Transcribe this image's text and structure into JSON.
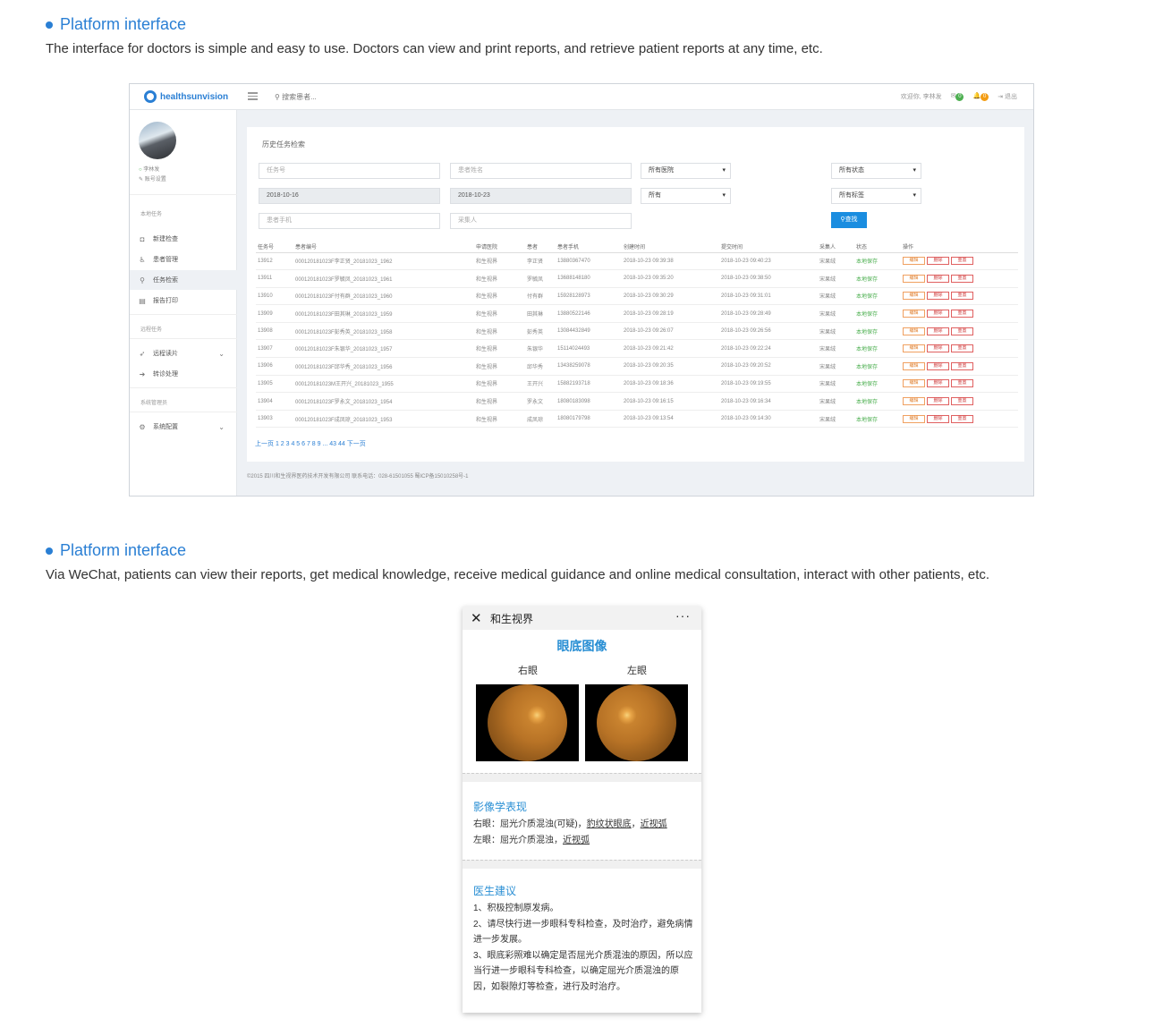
{
  "section1": {
    "title": "Platform interface",
    "desc": "The interface for doctors is simple and easy to use. Doctors can view and print reports, and retrieve patient reports at any time, etc."
  },
  "section2": {
    "title": "Platform interface",
    "desc": "Via WeChat, patients can view their reports, get medical knowledge, receive medical guidance and online medical consultation, interact with other patients, etc."
  },
  "dashboard": {
    "logo": "healthsunvision",
    "search_placeholder": "搜索患者...",
    "welcome": "欢迎你, 李林发",
    "badge_mail": "0",
    "badge_bell": "0",
    "logout": "退出",
    "user_name": "李林发",
    "account_settings": "账号设置",
    "groups": {
      "local": "本地任务",
      "remote": "远程任务",
      "admin": "系统管理员"
    },
    "nav": {
      "new_exam": "新建检查",
      "patient_mgmt": "患者管理",
      "task_search": "任务检索",
      "report_print": "报告打印",
      "remote_read": "远程读片",
      "referral": "转诊处理",
      "sys_config": "系统配置"
    },
    "panel_title": "历史任务检索",
    "filters": {
      "task_no": "任务号",
      "patient_name": "患者姓名",
      "hospital": "所有医院",
      "status": "所有状态",
      "date_from": "2018-10-16",
      "date_to": "2018-10-23",
      "all": "所有",
      "tags": "所有标签",
      "patient_phone": "患者手机",
      "collector": "采集人",
      "find_button": "查找"
    },
    "columns": [
      "任务号",
      "患者编号",
      "申请医院",
      "患者",
      "患者手机",
      "创建时间",
      "提交时间",
      "采集人",
      "状态",
      "操作"
    ],
    "rows": [
      [
        "13912",
        "000120181023F李正贤_20181023_1962",
        "和生视界",
        "李正贤",
        "13880367470",
        "2018-10-23 09:39:38",
        "2018-10-23 09:40:23",
        "宋果绒",
        "本地保存"
      ],
      [
        "13911",
        "000120181023F罗毓凤_20181023_1961",
        "和生视界",
        "罗毓凤",
        "13688148180",
        "2018-10-23 09:35:20",
        "2018-10-23 09:38:50",
        "宋果绒",
        "本地保存"
      ],
      [
        "13910",
        "000120181023F付有群_20181023_1960",
        "和生视界",
        "付有群",
        "15928128973",
        "2018-10-23 09:30:29",
        "2018-10-23 09:31:01",
        "宋果绒",
        "本地保存"
      ],
      [
        "13909",
        "000120181023F田其琳_20181023_1959",
        "和生视界",
        "田其琳",
        "13880522146",
        "2018-10-23 09:28:19",
        "2018-10-23 09:28:49",
        "宋果绒",
        "本地保存"
      ],
      [
        "13908",
        "000120181023F彭秀英_20181023_1958",
        "和生视界",
        "彭秀英",
        "13084432849",
        "2018-10-23 09:26:07",
        "2018-10-23 09:26:56",
        "宋果绒",
        "本地保存"
      ],
      [
        "13907",
        "000120181023F朱银华_20181023_1957",
        "和生视界",
        "朱银华",
        "15114024493",
        "2018-10-23 09:21:42",
        "2018-10-23 09:22:24",
        "宋果绒",
        "本地保存"
      ],
      [
        "13906",
        "000120181023F邱华秀_20181023_1956",
        "和生视界",
        "邱华秀",
        "13438259078",
        "2018-10-23 09:20:35",
        "2018-10-23 09:20:52",
        "宋果绒",
        "本地保存"
      ],
      [
        "13905",
        "000120181023M王开兴_20181023_1955",
        "和生视界",
        "王开兴",
        "15882193718",
        "2018-10-23 09:18:36",
        "2018-10-23 09:19:55",
        "宋果绒",
        "本地保存"
      ],
      [
        "13904",
        "000120181023F罗永文_20181023_1954",
        "和生视界",
        "罗永文",
        "18080183098",
        "2018-10-23 09:16:15",
        "2018-10-23 09:16:34",
        "宋果绒",
        "本地保存"
      ],
      [
        "13903",
        "000120181023F成凤琼_20181023_1953",
        "和生视界",
        "成凤琼",
        "18080179798",
        "2018-10-23 09:13:54",
        "2018-10-23 09:14:30",
        "宋果绒",
        "本地保存"
      ]
    ],
    "actions": {
      "edit": "编辑",
      "delete": "删除",
      "redo": "重置"
    },
    "pager": "上一页 1 2 3 4 5 6 7 8 9 ... 43 44 下一页",
    "footer": "©2015 四川和生视界医药技术开发有限公司 联系电话：028-61501055 蜀ICP备15010258号-1"
  },
  "mobile": {
    "app_title": "和生视界",
    "more": "···",
    "heading": "眼底图像",
    "right_eye": "右眼",
    "left_eye": "左眼",
    "imaging_title": "影像学表现",
    "imaging_right_prefix": "右眼：屈光介质混浊(可疑)，",
    "imaging_right_link1": "豹纹状眼底",
    "imaging_right_sep": "，",
    "imaging_right_link2": "近视弧",
    "imaging_left_prefix": "左眼：屈光介质混浊，",
    "imaging_left_link": "近视弧",
    "advice_title": "医生建议",
    "advice_1": "1、积极控制原发病。",
    "advice_2": "2、请尽快行进一步眼科专科检查，及时治疗，避免病情进一步发展。",
    "advice_3": "3、眼底彩照难以确定是否屈光介质混浊的原因，所以应当行进一步眼科专科检查，以确定屈光介质混浊的原因，如裂隙灯等检查，进行及时治疗。"
  }
}
